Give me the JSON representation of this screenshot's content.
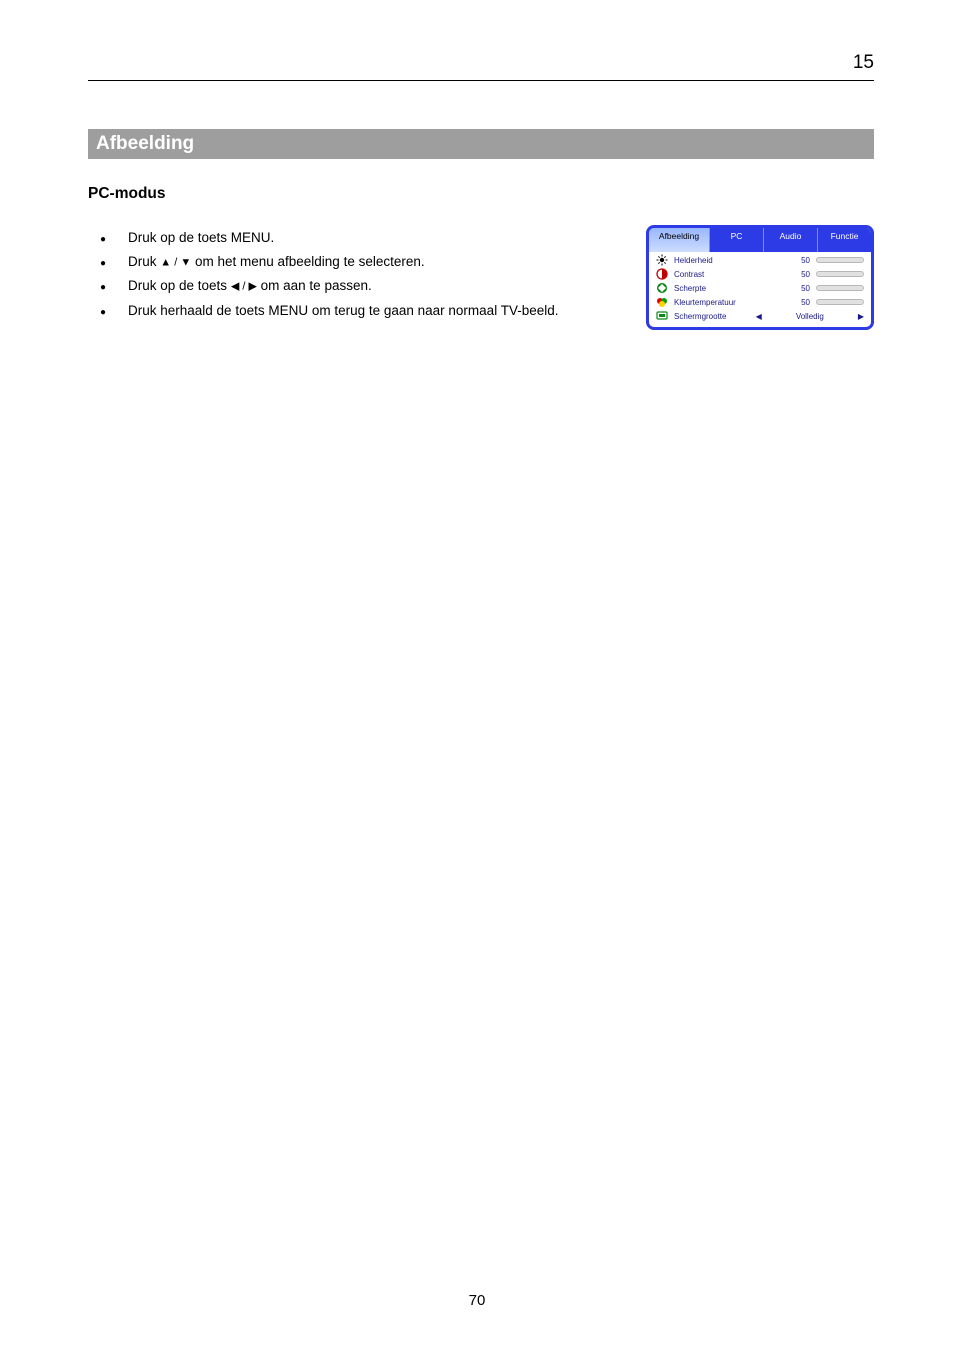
{
  "header": {
    "left": "",
    "right": "15"
  },
  "band_title": "Afbeelding",
  "subheading": "PC-modus",
  "instructions": {
    "items": [
      {
        "text": "Druk op de toets MENU."
      },
      {
        "text": "Druk ",
        "glyph": "▲ / ▼",
        "text2": " om het menu afbeelding te selecteren."
      },
      {
        "text": "Druk op de toets ",
        "glyph": "◀ / ▶",
        "text2": " om aan te passen."
      },
      {
        "text": "Druk herhaald de toets MENU om terug te gaan naar normaal TV-beeld."
      }
    ]
  },
  "osd": {
    "tabs": [
      "Afbeelding",
      "PC",
      "Audio",
      "Functie"
    ],
    "active_tab": 0,
    "rows": [
      {
        "icon": "brightness-icon",
        "label": "Helderheid",
        "value": 50,
        "type": "bar"
      },
      {
        "icon": "contrast-icon",
        "label": "Contrast",
        "value": 50,
        "type": "bar"
      },
      {
        "icon": "sharpness-icon",
        "label": "Scherpte",
        "value": 50,
        "type": "bar"
      },
      {
        "icon": "colortemp-icon",
        "label": "Kleurtemperatuur",
        "value": 50,
        "type": "bar"
      },
      {
        "icon": "screensize-icon",
        "label": "Schermgrootte",
        "value_text": "Volledig",
        "type": "arrows"
      }
    ]
  },
  "page_number": "70"
}
